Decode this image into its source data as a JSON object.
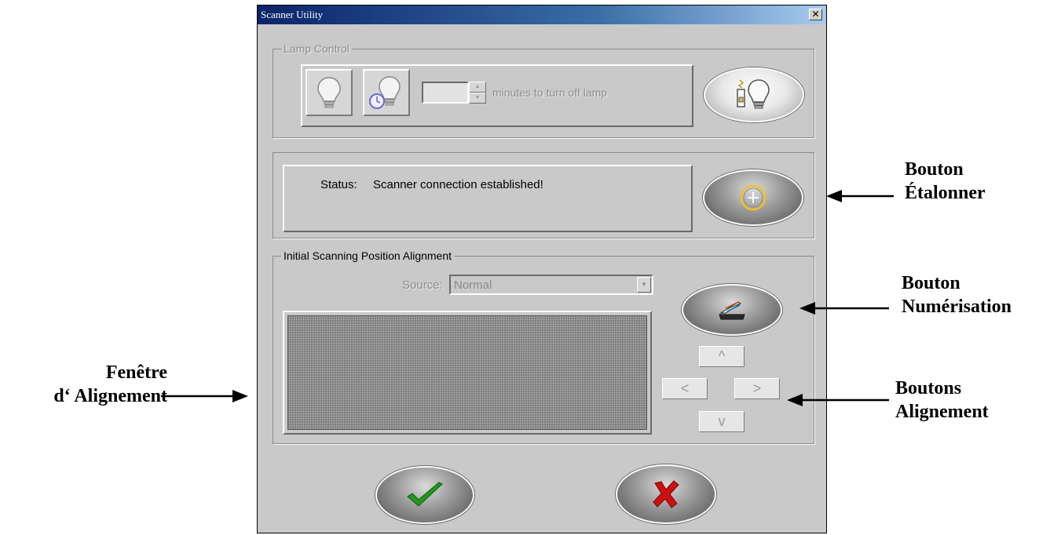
{
  "window": {
    "title": "Scanner Utility",
    "close_glyph": "✕"
  },
  "lamp_control": {
    "legend": "Lamp Control",
    "lamp_on_icon": "light-bulb-icon",
    "lamp_timer_icon": "clock-bulb-icon",
    "minutes_value": "",
    "minutes_label": "minutes to turn off lamp",
    "lamp_test_icon": "lamp-diagnostic-icon"
  },
  "status": {
    "label": "Status:",
    "value": "Scanner connection established!",
    "calibrate_icon": "calibrate-plus-icon"
  },
  "alignment": {
    "legend": "Initial Scanning Position Alignment",
    "source_label": "Source:",
    "source_value": "Normal",
    "scan_icon": "scanner-icon",
    "arrow_up": "^",
    "arrow_left": "<",
    "arrow_right": ">",
    "arrow_down": "v"
  },
  "footer": {
    "ok_icon": "checkmark-icon",
    "cancel_icon": "cross-icon"
  },
  "annotations": {
    "calibrate": [
      "Bouton",
      "Étalonner"
    ],
    "scan": [
      "Bouton",
      "Numérisation"
    ],
    "align_buttons": [
      "Boutons",
      "Alignement"
    ],
    "align_window": [
      "Fenêtre",
      "d‘ Alignement"
    ]
  },
  "colors": {
    "titlebar_start": "#0a246a",
    "titlebar_end": "#a6caf0",
    "dialog_bg": "#c9c9c9",
    "ok_green": "#1f9a1f",
    "cancel_red": "#cc1010"
  }
}
